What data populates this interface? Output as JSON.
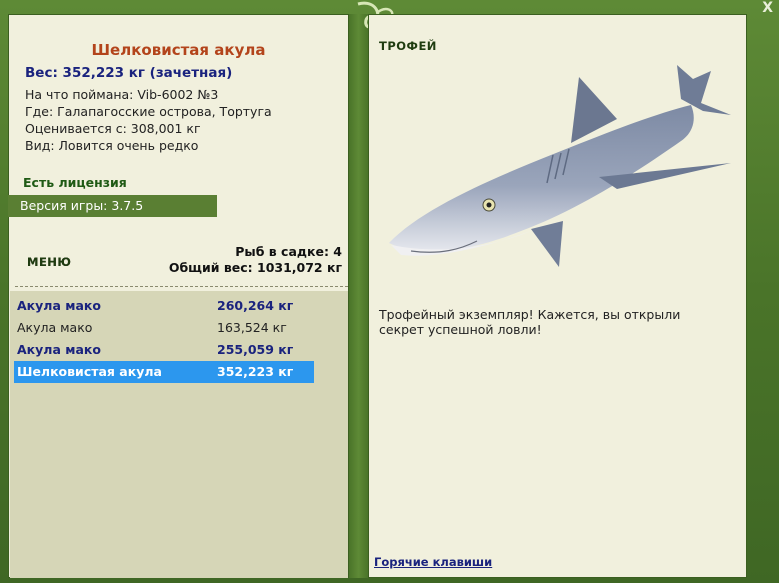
{
  "window": {
    "close_label": "X"
  },
  "fish": {
    "name": "Шелковистая акула",
    "weight_line": "Вес: 352,223 кг (зачетная)",
    "bait": "На что поймана: Vib-6002 №3",
    "location": "Где: Галапагосские острова, Тортуга",
    "value": "Оценивается с: 308,001 кг",
    "rarity": "Вид: Ловится очень редко"
  },
  "license_text": "Есть лицензия",
  "version_text": "Версия игры: 3.7.5",
  "menu": {
    "label": "МЕНЮ",
    "fish_count": "Рыб в садке: 4",
    "total_weight": "Общий вес: 1031,072 кг"
  },
  "catch_list": [
    {
      "name": "Акула мако",
      "weight": "260,264 кг",
      "style": "bold"
    },
    {
      "name": "Акула мако",
      "weight": "163,524 кг",
      "style": "plain"
    },
    {
      "name": "Акула мако",
      "weight": "255,059 кг",
      "style": "bold"
    },
    {
      "name": "Шелковистая акула",
      "weight": "352,223 кг",
      "style": "selected"
    }
  ],
  "trophy": {
    "heading": "ТРОФЕЙ",
    "description": "Трофейный экземпляр! Кажется, вы открыли секрет успешной ловли!",
    "image_icon": "shark-illustration"
  },
  "hotkeys_link": "Горячие клавиши",
  "colors": {
    "frame_green": "#4e7a2c",
    "panel_bg": "#f1f0dd",
    "title_orange": "#b3441b",
    "navy": "#1a237e",
    "selection_blue": "#2c97ee"
  }
}
